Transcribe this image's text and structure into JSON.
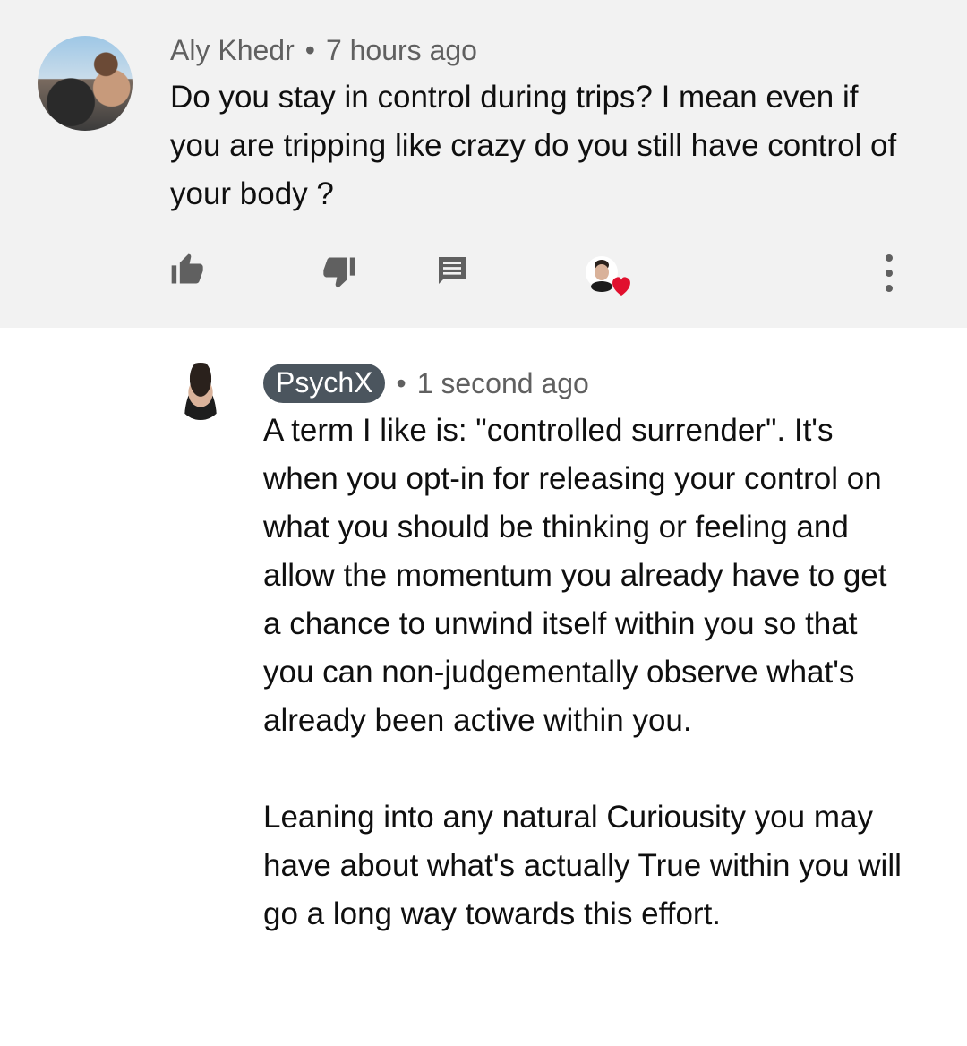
{
  "comment": {
    "author": "Aly Khedr",
    "separator": "•",
    "time": "7 hours ago",
    "text": "Do you stay in control during trips? I mean even if you are tripping like crazy do you still have control of your body ?",
    "actions": {
      "like_icon": "thumb-up-icon",
      "dislike_icon": "thumb-down-icon",
      "reply_icon": "comment-icon",
      "creator_heart_icon": "creator-heart-icon",
      "more_icon": "more-vertical-icon"
    },
    "heart_color": "#e1102e"
  },
  "reply": {
    "author": "PsychX",
    "separator": "•",
    "time": "1 second ago",
    "text": "A term I like is: \"controlled surrender\". It's when you opt-in for releasing your control on what you should be thinking or feeling and allow the momentum you already have to get a chance to unwind itself within you so that you can non-judgementally observe what's already been active within you.\n\nLeaning into any natural Curiousity you may have about what's actually True within you will go a long way towards this effort.",
    "badge_color": "#4b555e"
  }
}
